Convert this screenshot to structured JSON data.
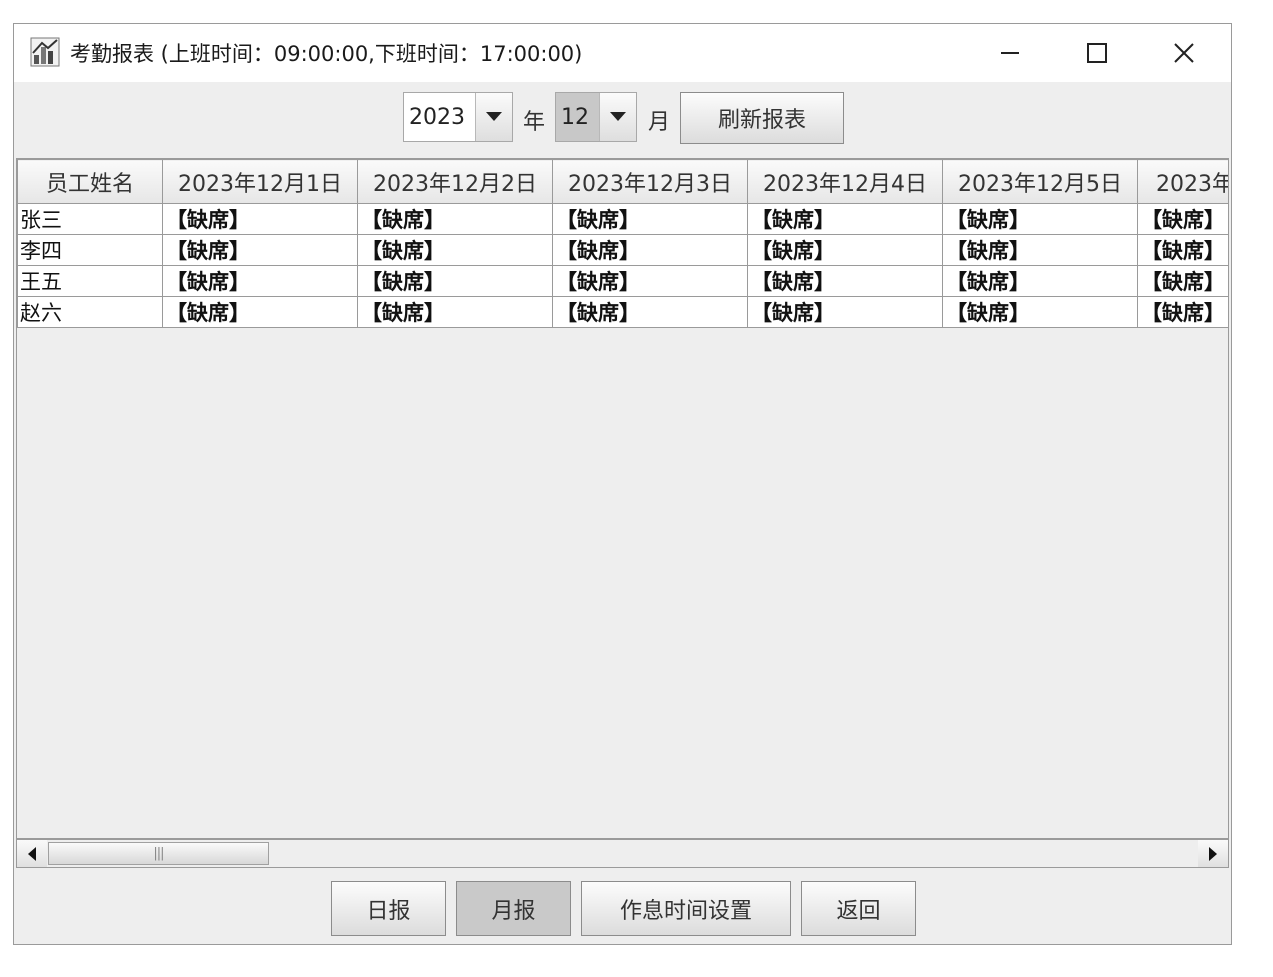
{
  "window": {
    "title": "考勤报表 (上班时间：09:00:00,下班时间：17:00:00)"
  },
  "filters": {
    "year": "2023",
    "year_label": "年",
    "month": "12",
    "month_label": "月",
    "refresh_label": "刷新报表"
  },
  "table": {
    "headers": [
      "员工姓名",
      "2023年12月1日",
      "2023年12月2日",
      "2023年12月3日",
      "2023年12月4日",
      "2023年12月5日",
      "2023年"
    ],
    "rows": [
      {
        "name": "张三",
        "cells": [
          "【缺席】",
          "【缺席】",
          "【缺席】",
          "【缺席】",
          "【缺席】",
          "【缺席】"
        ]
      },
      {
        "name": "李四",
        "cells": [
          "【缺席】",
          "【缺席】",
          "【缺席】",
          "【缺席】",
          "【缺席】",
          "【缺席】"
        ]
      },
      {
        "name": "王五",
        "cells": [
          "【缺席】",
          "【缺席】",
          "【缺席】",
          "【缺席】",
          "【缺席】",
          "【缺席】"
        ]
      },
      {
        "name": "赵六",
        "cells": [
          "【缺席】",
          "【缺席】",
          "【缺席】",
          "【缺席】",
          "【缺席】",
          "【缺席】"
        ]
      }
    ]
  },
  "footer": {
    "daily_label": "日报",
    "monthly_label": "月报",
    "schedule_label": "作息时间设置",
    "back_label": "返回"
  },
  "icons": {
    "app": "chart-app-icon",
    "minimize": "minimize-icon",
    "maximize": "maximize-icon",
    "close": "close-icon",
    "dropdown": "chevron-down-icon",
    "scroll_left": "arrow-left-icon",
    "scroll_right": "arrow-right-icon"
  }
}
